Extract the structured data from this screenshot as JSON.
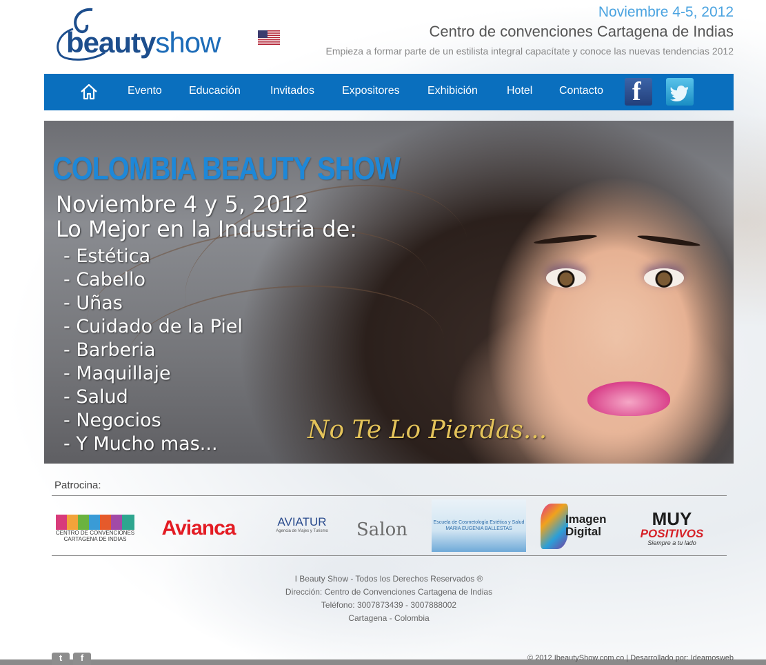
{
  "header": {
    "logo_text_a": "beauty",
    "logo_text_b": "show",
    "date": "Noviembre 4-5, 2012",
    "venue": "Centro de convenciones Cartagena de Indias",
    "tagline": "Empieza a formar parte de un estilista integral capacítate y conoce las nuevas tendencias 2012"
  },
  "nav": {
    "items": [
      {
        "label": "Evento"
      },
      {
        "label": "Educación"
      },
      {
        "label": "Invitados"
      },
      {
        "label": "Expositores"
      },
      {
        "label": "Exhibición"
      },
      {
        "label": "Hotel"
      },
      {
        "label": "Contacto"
      }
    ],
    "icons": [
      "home-icon",
      "facebook-icon",
      "twitter-icon"
    ],
    "color": "#0a6fbe"
  },
  "banner": {
    "title": "COLOMBIA BEAUTY SHOW",
    "line1": "Noviembre 4 y 5, 2012",
    "line2": "Lo Mejor en la Industria de:",
    "list": [
      "- Estética",
      "- Cabello",
      "- Uñas",
      "- Cuidado de la Piel",
      "- Barberia",
      "- Maquillaje",
      "- Salud",
      "- Negocios",
      "- Y Mucho mas..."
    ],
    "cta": "No Te Lo Pierdas..."
  },
  "sponsors": {
    "label": "Patrocina:",
    "ccci": "CENTRO DE CONVENCIONES CARTAGENA DE INDIAS",
    "avianca": "Avianca",
    "aviatur": "AVIATUR",
    "aviatur_sub": "Agencia de Viajes y Turismo",
    "salon": "Salon",
    "escuela": "Escuela de Cosmetología Estética y Salud MARIA EUGENIA BALLESTAS",
    "imagen": "Imagen Digital",
    "muy": "MUY",
    "positivos": "POSITIVOS",
    "muy_sub": "Siempre a tu lado"
  },
  "footer": {
    "rights": "I Beauty Show - Todos los Derechos Reservados ®",
    "address": "Dirección: Centro de Convenciones Cartagena de Indias",
    "phone": "Teléfono: 3007873439 - 3007888002",
    "city": "Cartagena - Colombia",
    "copyright": "© 2012 IbeautyShow.com.co | Desarrollado por: Ideamosweb"
  }
}
